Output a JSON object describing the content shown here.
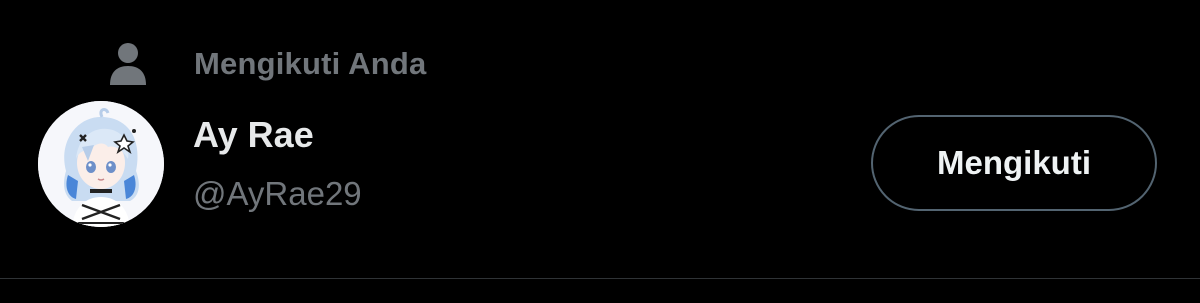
{
  "follows_you": {
    "label": "Mengikuti Anda",
    "icon": "person-icon"
  },
  "user": {
    "display_name": "Ay Rae",
    "handle": "@AyRae29",
    "avatar": "avatar-anime-girl"
  },
  "follow_button": {
    "label": "Mengikuti"
  },
  "colors": {
    "background": "#000000",
    "primary_text": "#e7e9ea",
    "secondary_text": "#71767b",
    "button_border": "#536471",
    "divider": "#2f3336"
  }
}
